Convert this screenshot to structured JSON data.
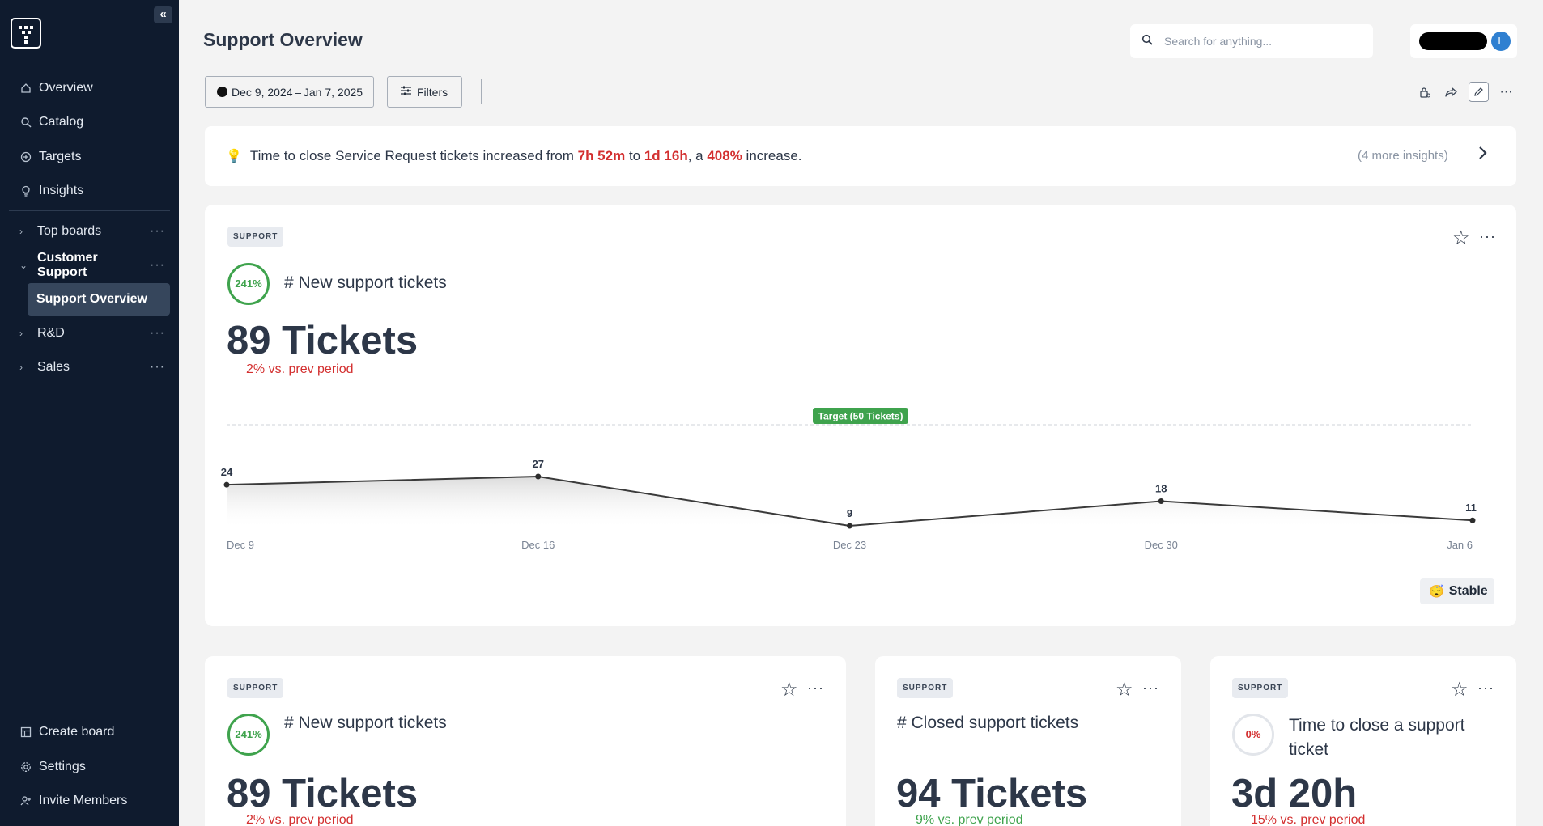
{
  "sidebar": {
    "collapse_icon": "chevrons-left-icon",
    "nav": [
      {
        "label": "Overview",
        "icon": "home-icon"
      },
      {
        "label": "Catalog",
        "icon": "search-icon"
      },
      {
        "label": "Targets",
        "icon": "target-icon"
      },
      {
        "label": "Insights",
        "icon": "lightbulb-icon"
      }
    ],
    "groups": [
      {
        "label": "Top boards",
        "expanded": false
      },
      {
        "label": "Customer Support",
        "expanded": true
      },
      {
        "label": "R&D",
        "expanded": false
      },
      {
        "label": "Sales",
        "expanded": false
      }
    ],
    "active_board": "Support Overview",
    "bottom": [
      {
        "label": "Create board",
        "icon": "grid-icon"
      },
      {
        "label": "Settings",
        "icon": "gear-icon"
      },
      {
        "label": "Invite Members",
        "icon": "user-plus-icon"
      }
    ]
  },
  "header": {
    "title": "Support Overview",
    "search_placeholder": "Search for anything...",
    "avatar_initial": "L"
  },
  "toolbar": {
    "date_range": "Dec 9, 2024 – Jan 7, 2025",
    "filters_label": "Filters"
  },
  "insight": {
    "text_1": "Time to close Service Request tickets increased from ",
    "from": "7h 52m",
    "text_2": " to ",
    "to": "1d 16h",
    "text_3": ", a ",
    "pct": "408%",
    "text_4": " increase.",
    "more": "(4 more insights)"
  },
  "main_card": {
    "tag": "SUPPORT",
    "ring": "241%",
    "name": "# New support tickets",
    "value": "89 Tickets",
    "delta": "2% vs. prev period",
    "status": "Stable",
    "chart_data": {
      "type": "area",
      "x": [
        "Dec 9",
        "Dec 16",
        "Dec 23",
        "Dec 30",
        "Jan 6"
      ],
      "values": [
        24,
        27,
        9,
        18,
        11
      ],
      "target_label": "Target (50 Tickets)",
      "target": 50,
      "colors": {
        "line": "#3a3a3a",
        "target": "#3fa34d"
      }
    }
  },
  "cards": [
    {
      "tag": "SUPPORT",
      "ring": "241%",
      "name": "# New support tickets",
      "value": "89 Tickets",
      "delta": "2% vs. prev period",
      "delta_dir": "up-bad"
    },
    {
      "tag": "SUPPORT",
      "name": "# Closed support tickets",
      "value": "94 Tickets",
      "delta": "9% vs. prev period",
      "delta_dir": "up-good"
    },
    {
      "tag": "SUPPORT",
      "ring": "0%",
      "name": "Time to close a support ticket",
      "value": "3d 20h",
      "delta": "15% vs. prev period",
      "delta_dir": "up-bad"
    }
  ]
}
